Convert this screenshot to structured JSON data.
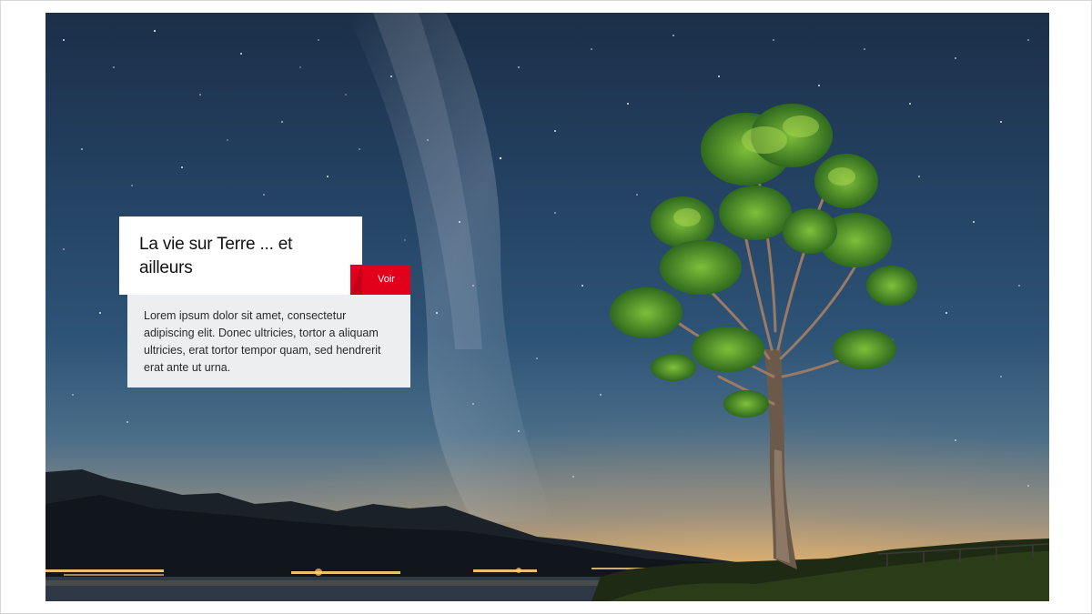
{
  "hero": {
    "image_alt": "Night sky with milky way over a lake and mountains, a lone pine tree on the right"
  },
  "card": {
    "title": "La vie sur Terre ... et ailleurs",
    "button_label": "Voir",
    "description": "Lorem ipsum dolor sit amet, consectetur adipiscing elit. Donec ultricies, tortor a aliquam ultricies, erat tortor tempor quam, sed hendrerit erat ante ut urna."
  },
  "colors": {
    "accent": "#e3001b",
    "title_bg": "#ffffff",
    "description_bg": "#eceeef"
  }
}
